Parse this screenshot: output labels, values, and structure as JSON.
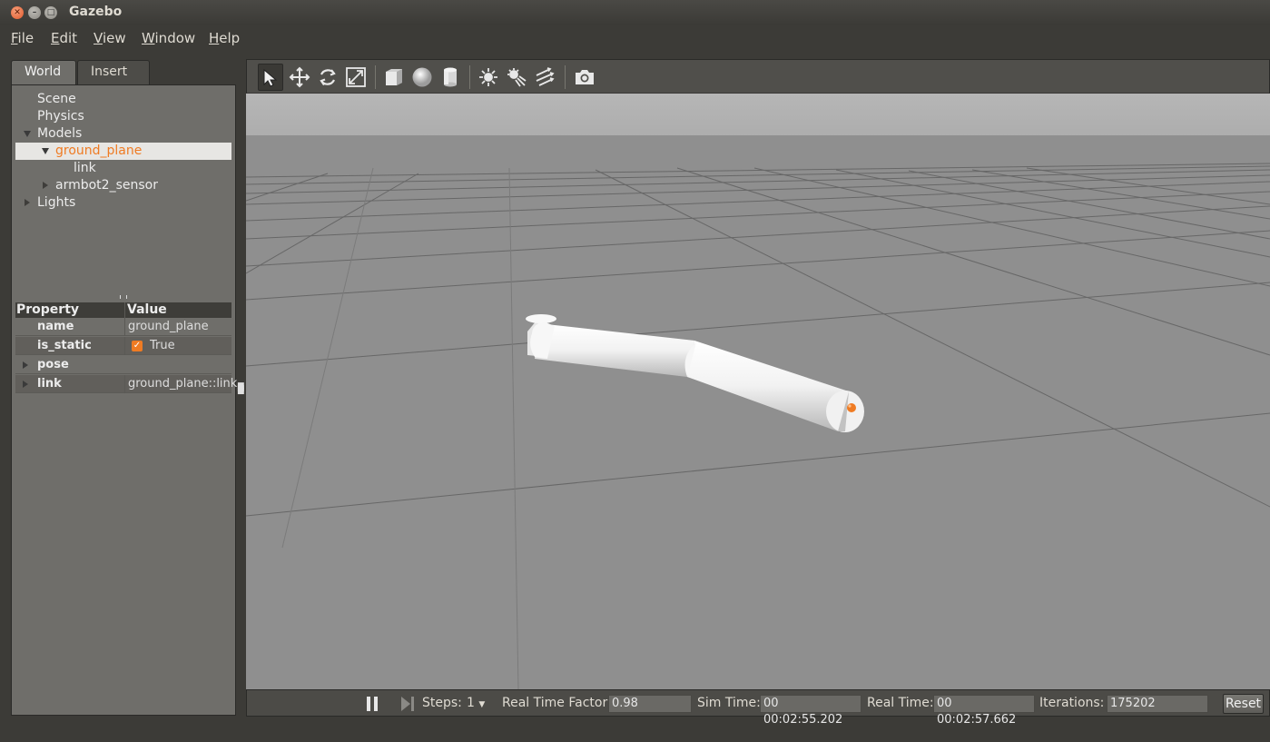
{
  "window": {
    "title": "Gazebo"
  },
  "menu": [
    {
      "accel": "F",
      "rest": "ile"
    },
    {
      "accel": "E",
      "rest": "dit"
    },
    {
      "accel": "V",
      "rest": "iew"
    },
    {
      "accel": "W",
      "rest": "indow"
    },
    {
      "accel": "H",
      "rest": "elp"
    }
  ],
  "tabs": {
    "world": "World",
    "insert": "Insert"
  },
  "tree": {
    "scene": "Scene",
    "physics": "Physics",
    "models": "Models",
    "ground_plane": "ground_plane",
    "link": "link",
    "armbot": "armbot2_sensor",
    "lights": "Lights"
  },
  "properties": {
    "header_property": "Property",
    "header_value": "Value",
    "rows": [
      {
        "key": "name",
        "value": "ground_plane"
      },
      {
        "key": "is_static",
        "value": "True",
        "checked": true
      },
      {
        "key": "pose",
        "value": ""
      },
      {
        "key": "link",
        "value": "ground_plane::link"
      }
    ]
  },
  "toolbar": {
    "icons": [
      "select-arrow-icon",
      "translate-icon",
      "rotate-icon",
      "scale-icon",
      "box-icon",
      "sphere-icon",
      "cylinder-icon",
      "point-light-icon",
      "spot-light-icon",
      "directional-light-icon",
      "camera-icon"
    ]
  },
  "bottombar": {
    "steps_label": "Steps:",
    "steps_value": "1",
    "rtf_label": "Real Time Factor:",
    "rtf_value": "0.98",
    "sim_time_label": "Sim Time:",
    "sim_time_value": "00 00:02:55.202",
    "real_time_label": "Real Time:",
    "real_time_value": "00 00:02:57.662",
    "iterations_label": "Iterations:",
    "iterations_value": "175202",
    "reset_label": "Reset"
  },
  "colors": {
    "accent": "#ef7b23",
    "panel": "#6f6e6a",
    "chrome": "#3c3b37",
    "ground": "#8f8f8f",
    "sky": "#b3b3b3"
  }
}
